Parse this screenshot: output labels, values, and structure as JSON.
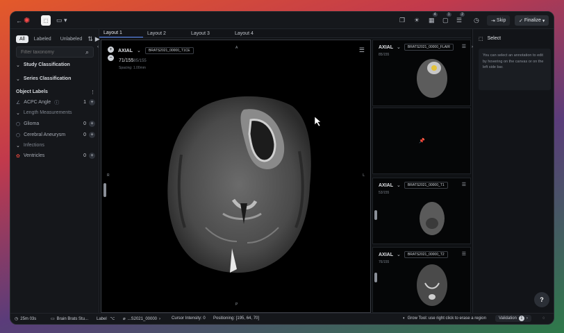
{
  "topbar": {
    "skip_label": "Skip",
    "finalize_label": "Finalize",
    "badges": [
      "4",
      "1",
      "2"
    ],
    "icons": [
      "back-icon",
      "logo-icon",
      "select-tool-icon",
      "layout-icon",
      "stack-icon",
      "sun-icon",
      "task-icon",
      "comment-icon",
      "list-icon",
      "history-icon"
    ]
  },
  "left_panel": {
    "filters": [
      "All",
      "Labeled",
      "Unlabeled"
    ],
    "search_placeholder": "Filter taxonomy",
    "study_classification": "Study Classification",
    "series_classification": "Series Classification",
    "object_labels": "Object Labels",
    "items": [
      {
        "label": "ACPC Angle",
        "count": "1",
        "color": "#7c8594"
      },
      {
        "label": "Length Measurements",
        "count": "",
        "color": "#7c8594"
      },
      {
        "label": "Glioma",
        "count": "0",
        "color": "#8a93a3"
      },
      {
        "label": "Cerebral Aneurysm",
        "count": "0",
        "color": "#8a93a3"
      },
      {
        "label": "Infections",
        "count": "",
        "color": "#7c8594"
      },
      {
        "label": "Ventricles",
        "count": "0",
        "color": "#e0463c"
      }
    ]
  },
  "layouts": [
    "Layout 1",
    "Layout 2",
    "Layout 3",
    "Layout 4"
  ],
  "viewport": {
    "plane": "AXIAL",
    "series": "BRATS2021_00000_T1CE",
    "slice": "71/155",
    "slice_sub": "85/155",
    "spacing": "Spacing: 1.00mm",
    "orient_top": "A",
    "orient_left": "R",
    "orient_right": "L",
    "orient_bottom": "P"
  },
  "thumbnails": [
    {
      "plane": "AXIAL",
      "series": "BRATS2021_00000_FLAIR",
      "count": "85/155"
    },
    {
      "plane": "",
      "series": "",
      "count": ""
    },
    {
      "plane": "AXIAL",
      "series": "BRATS2021_00000_T1",
      "count": "53/155"
    },
    {
      "plane": "AXIAL",
      "series": "BRATS2021_00000_T2",
      "count": "76/155"
    }
  ],
  "select_panel": {
    "title": "Select",
    "hint": "You can select an annotation to edit by hovering on the canvas or on the left side bar."
  },
  "statusbar": {
    "timer": "25m 03s",
    "project": "Brain Brats Stu...",
    "label": "Label",
    "file": "...S2021_00000",
    "cursor_intensity": "Cursor Intensity: 0",
    "positioning": "Positioning: [195, 64, 70]",
    "tool_hint": "Grow Tool: use right click to erase a region",
    "validation": "Validation",
    "validation_count": "1"
  },
  "help_label": "?"
}
